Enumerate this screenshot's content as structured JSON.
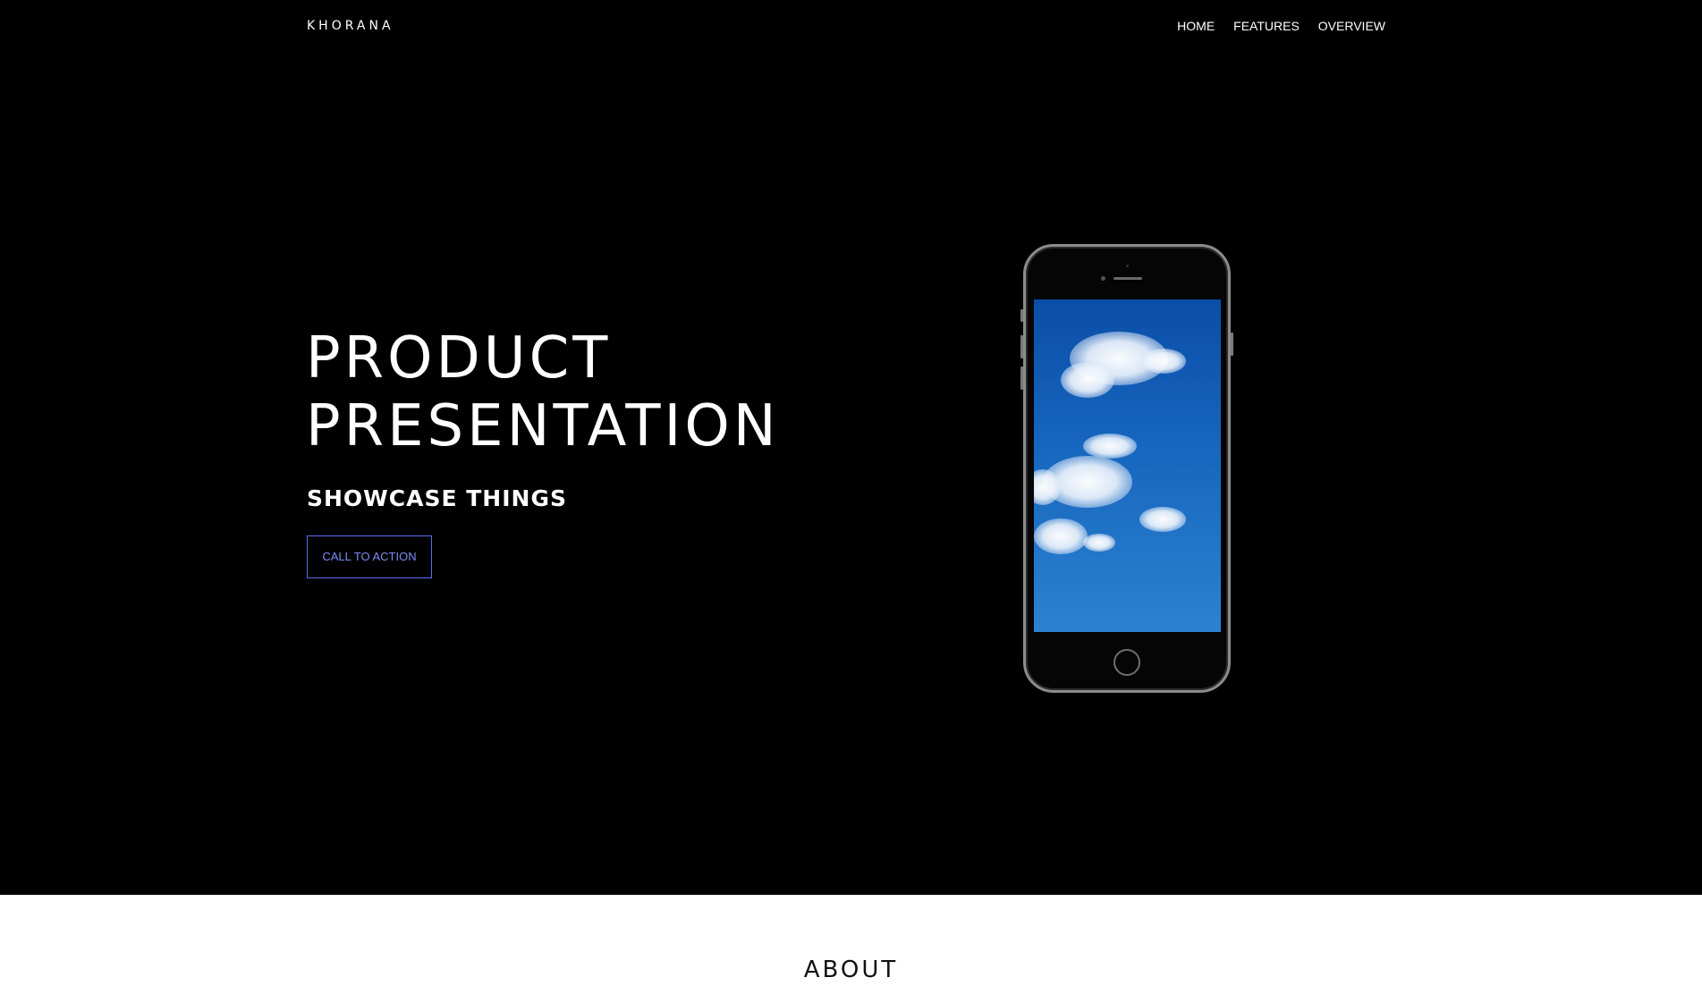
{
  "header": {
    "brand": "KHORANA",
    "nav": [
      {
        "label": "HOME"
      },
      {
        "label": "FEATURES"
      },
      {
        "label": "OVERVIEW"
      }
    ]
  },
  "hero": {
    "title_line1": "PRODUCT",
    "title_line2": "PRESENTATION",
    "subtitle": "SHOWCASE THINGS",
    "cta_label": "CALL TO ACTION"
  },
  "about": {
    "heading": "ABOUT"
  },
  "colors": {
    "hero_background": "#000000",
    "cta_accent": "#5a6cf0",
    "page_background": "#ffffff"
  },
  "icons": {
    "hero_image": "smartphone-with-sky-wallpaper"
  }
}
